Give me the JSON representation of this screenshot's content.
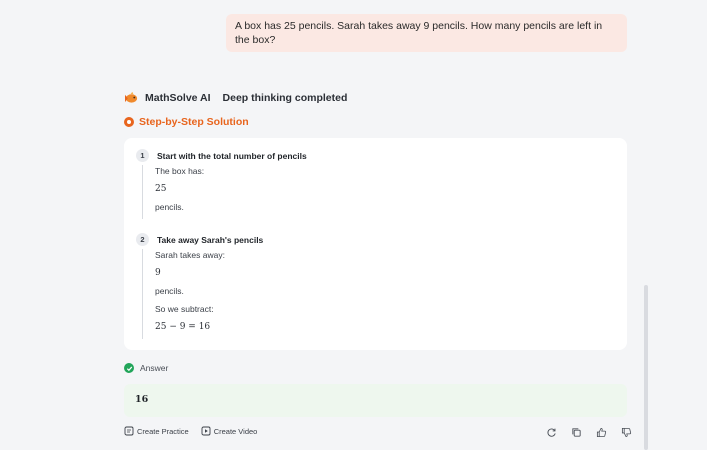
{
  "user_message": "A box has 25 pencils. Sarah takes away 9 pencils. How many pencils are left in the box?",
  "assistant": {
    "name": "MathSolve AI",
    "status": "Deep thinking completed"
  },
  "solution": {
    "title": "Step-by-Step Solution",
    "steps": [
      {
        "number": "1",
        "title": "Start with the total number of pencils",
        "lines": [
          "The box has:",
          "25",
          "pencils."
        ]
      },
      {
        "number": "2",
        "title": "Take away Sarah's pencils",
        "lines": [
          "Sarah takes away:",
          "9",
          "pencils.",
          "So we subtract:",
          "25 − 9 = 16"
        ]
      }
    ]
  },
  "answer": {
    "label": "Answer",
    "value": "16"
  },
  "actions": {
    "create_practice": "Create Practice",
    "create_video": "Create Video"
  },
  "icons": {
    "logo": "fish-logo-icon",
    "check": "check-circle-icon",
    "regenerate": "refresh-icon",
    "copy": "copy-icon",
    "like": "thumbs-up-icon",
    "dislike": "thumbs-down-icon"
  },
  "colors": {
    "accent": "#e8651e",
    "user_bubble": "#fbe8e3",
    "answer_bg": "#eef7ee",
    "check": "#22a55a"
  }
}
